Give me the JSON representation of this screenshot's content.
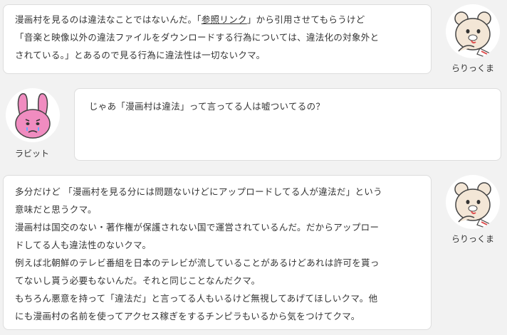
{
  "messages": [
    {
      "speaker": "らりっくま",
      "side": "right",
      "lines": [
        {
          "before": "漫画村を見るのは違法なことではないんだ。「",
          "link": "参照リンク",
          "after": "」から引用させてもらうけど"
        },
        {
          "text": "「音楽と映像以外の違法ファイルをダウンロードする行為については、違法化の対象外と"
        },
        {
          "text": "されている。」とあるので見る行為に違法性は一切ないクマ。"
        }
      ]
    },
    {
      "speaker": "ラビット",
      "side": "left",
      "lines": [
        {
          "text": "じゃあ「漫画村は違法」って言ってる人は嘘ついてるの？"
        }
      ]
    },
    {
      "speaker": "らりっくま",
      "side": "right",
      "lines": [
        {
          "text": "多分だけど 「漫画村を見る分には問題ないけどにアップロードしてる人が違法だ」という"
        },
        {
          "text": "意味だと思うクマ。"
        },
        {
          "text": "漫画村は国交のない・著作権が保護されない国で運営されているんだ。だからアップロー"
        },
        {
          "text": "ドしてる人も違法性のないクマ。"
        },
        {
          "text": "例えば北朝鮮のテレビ番組を日本のテレビが流していることがあるけどあれは許可を貰っ"
        },
        {
          "text": "てないし貰う必要もないんだ。それと同じことなんだクマ。"
        },
        {
          "text": "もちろん悪意を持って「違法だ」と言ってる人もいるけど無視してあげてほしいクマ。他"
        },
        {
          "text": "にも漫画村の名前を使ってアクセス稼ぎをするチンピラもいるから気をつけてクマ。"
        }
      ]
    }
  ],
  "colors": {
    "background": "#f2f2f2",
    "bubble": "#ffffff",
    "bubble_border": "#dddddd",
    "text": "#333333",
    "rabbit_pink": "#f08cc0"
  },
  "icons": {
    "bear": "bear-avatar-icon",
    "rabbit": "rabbit-avatar-icon"
  }
}
